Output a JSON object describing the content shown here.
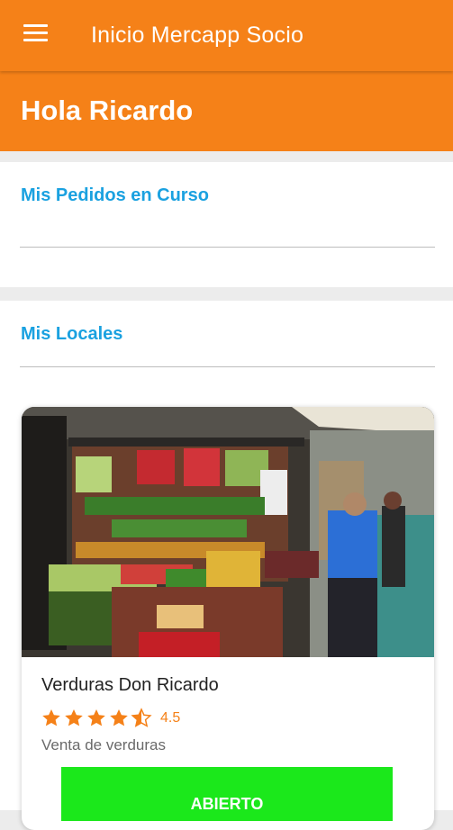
{
  "app_bar": {
    "title": "Inicio Mercapp Socio",
    "menu_icon": "hamburger-menu-icon",
    "color": "#f58118"
  },
  "greeting": {
    "text": "Hola Ricardo"
  },
  "orders_section": {
    "title": "Mis Pedidos en Curso"
  },
  "locales_section": {
    "title": "Mis Locales",
    "locales": [
      {
        "name": "Verduras Don Ricardo",
        "rating_value": "4.5",
        "rating": 4.5,
        "rating_max": 5,
        "description": "Venta de verduras",
        "status_label": "ABIERTO",
        "status_color": "#1be81b"
      }
    ]
  },
  "colors": {
    "accent": "#f58118",
    "section_title": "#1aa1e0",
    "open_status": "#1be81b"
  }
}
